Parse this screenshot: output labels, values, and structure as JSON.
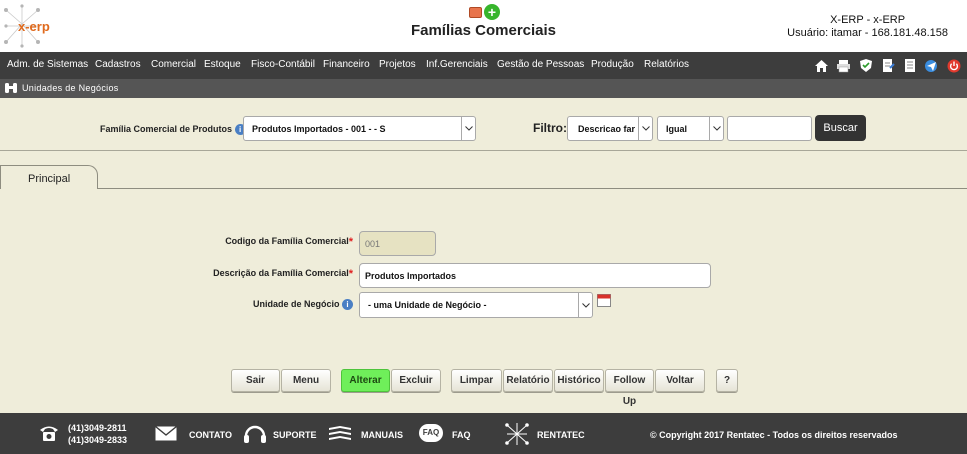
{
  "header": {
    "logo_text": "x-erp",
    "title": "Famílias Comerciais",
    "system": "X-ERP - x-ERP",
    "user_info": "Usuário: itamar - 168.181.48.158"
  },
  "menu": {
    "items": [
      "Adm. de Sistemas",
      "Cadastros",
      "Comercial",
      "Estoque",
      "Fisco-Contábil",
      "Financeiro",
      "Projetos",
      "Inf.Gerenciais",
      "Gestão de Pessoas",
      "Produção",
      "Relatórios"
    ]
  },
  "breadcrumb": {
    "label": "Unidades de Negócios"
  },
  "filter": {
    "family_label": "Família Comercial de Produtos",
    "family_value": "Produtos Importados - 001 - - S",
    "filtro_label": "Filtro:",
    "field_value": "Descricao far",
    "operator_value": "Igual",
    "search_value": "",
    "search_button": "Buscar"
  },
  "tabs": {
    "principal": "Principal"
  },
  "form": {
    "code_label": "Codigo da Família Comercial",
    "code_value": "001",
    "desc_label": "Descrição da Família Comercial",
    "desc_value": "Produtos Importados",
    "unit_label": "Unidade de Negócio",
    "unit_value": "- uma Unidade de Negócio -",
    "required_mark": "*"
  },
  "buttons": {
    "sair": "Sair",
    "menu": "Menu",
    "alterar": "Alterar",
    "excluir": "Excluir",
    "limpar": "Limpar",
    "relatorio": "Relatório",
    "historico": "Histórico",
    "follow_up": "Follow Up",
    "voltar": "Voltar",
    "help": "?"
  },
  "footer": {
    "phone1": "(41)3049-2811",
    "phone2": "(41)3049-2833",
    "contato": "CONTATO",
    "suporte": "SUPORTE",
    "manuais": "MANUAIS",
    "faq": "FAQ",
    "faq_icon_text": "FAQ",
    "rentatec": "RENTATEC",
    "copyright": "© Copyright 2017 Rentatec - Todos os direitos reservados"
  },
  "colors": {
    "accent_green": "#6fef5a",
    "menu_bg": "#3d3d3d",
    "page_bg": "#efedda"
  }
}
